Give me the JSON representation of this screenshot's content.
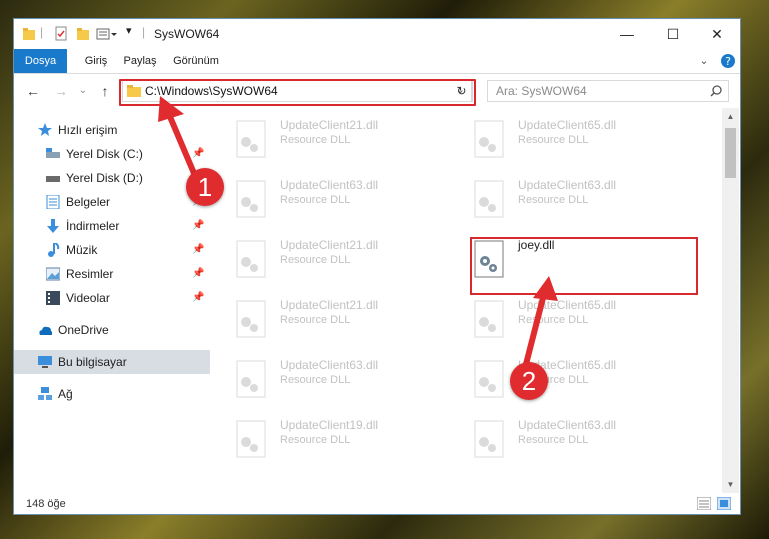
{
  "window": {
    "title": "SysWOW64",
    "controls": {
      "minimize": "—",
      "maximize": "☐",
      "close": "✕"
    }
  },
  "ribbon": {
    "tabs": [
      "Dosya",
      "Giriş",
      "Paylaş",
      "Görünüm"
    ]
  },
  "address": {
    "path": "C:\\Windows\\SysWOW64",
    "search_placeholder": "Ara: SysWOW64"
  },
  "nav": {
    "items": [
      {
        "label": "Hızlı erişim",
        "icon": "star-icon"
      },
      {
        "label": "Yerel Disk (C:)",
        "icon": "drive-icon",
        "pinned": true
      },
      {
        "label": "Yerel Disk (D:)",
        "icon": "drive-icon",
        "pinned": true
      },
      {
        "label": "Belgeler",
        "icon": "document-icon",
        "pinned": true
      },
      {
        "label": "İndirmeler",
        "icon": "download-icon",
        "pinned": true
      },
      {
        "label": "Müzik",
        "icon": "music-icon",
        "pinned": true
      },
      {
        "label": "Resimler",
        "icon": "pictures-icon",
        "pinned": true
      },
      {
        "label": "Videolar",
        "icon": "video-icon",
        "pinned": true
      },
      {
        "label": "OneDrive",
        "icon": "cloud-icon"
      },
      {
        "label": "Bu bilgisayar",
        "icon": "computer-icon",
        "selected": true
      },
      {
        "label": "Ağ",
        "icon": "network-icon"
      }
    ]
  },
  "files": {
    "left": [
      {
        "name": "UpdateClient21.dll",
        "desc": "Resource DLL"
      },
      {
        "name": "UpdateClient63.dll",
        "desc": "Resource DLL"
      },
      {
        "name": "UpdateClient21.dll",
        "desc": "Resource DLL"
      },
      {
        "name": "UpdateClient21.dll",
        "desc": "Resource DLL"
      },
      {
        "name": "UpdateClient63.dll",
        "desc": "Resource DLL"
      },
      {
        "name": "UpdateClient19.dll",
        "desc": "Resource DLL"
      }
    ],
    "right": [
      {
        "name": "UpdateClient65.dll",
        "desc": "Resource DLL"
      },
      {
        "name": "UpdateClient63.dll",
        "desc": "Resource DLL"
      },
      {
        "name": "joey.dll",
        "desc": ""
      },
      {
        "name": "UpdateClient65.dll",
        "desc": "Resource DLL"
      },
      {
        "name": "UpdateClient65.dll",
        "desc": "Resource DLL"
      },
      {
        "name": "UpdateClient63.dll",
        "desc": "Resource DLL"
      }
    ]
  },
  "status": {
    "count": "148 öğe"
  },
  "annotations": {
    "step1": "1",
    "step2": "2"
  },
  "colors": {
    "accent": "#1979ca",
    "highlight": "#d9292f",
    "selected": "#d8dce3"
  }
}
